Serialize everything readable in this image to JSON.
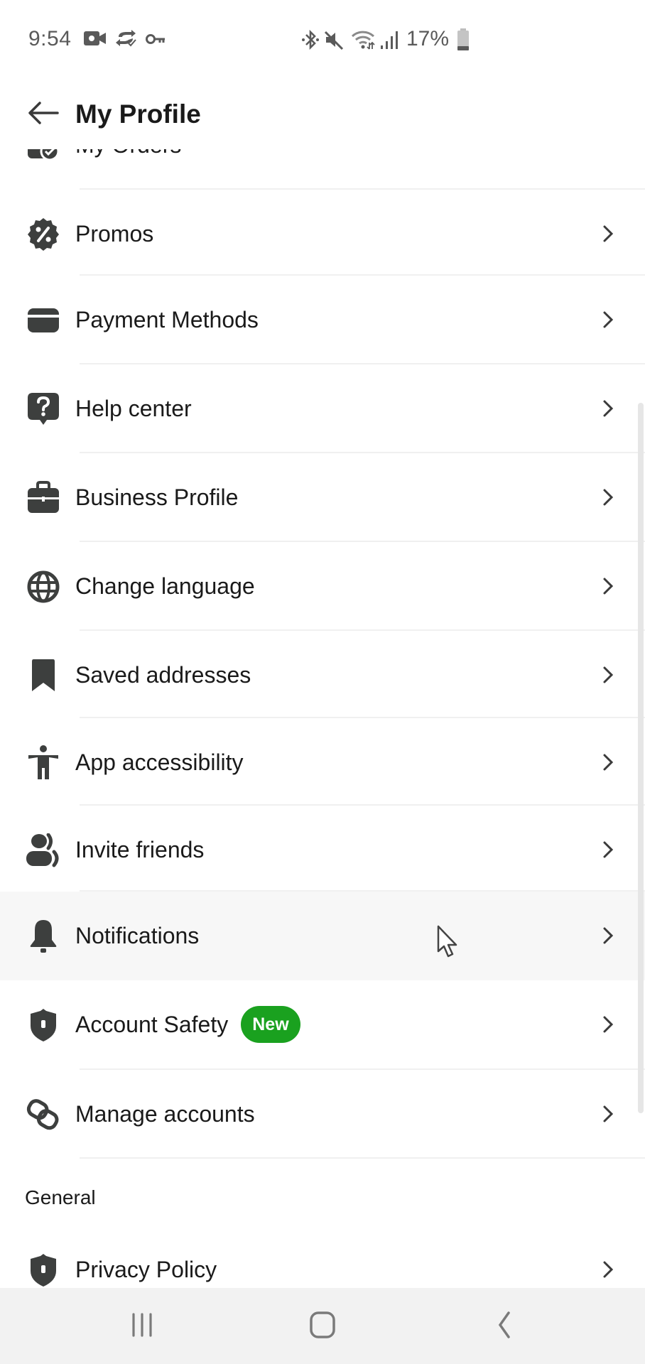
{
  "status_bar": {
    "time": "9:54",
    "left_icons": [
      "video-call-icon",
      "sync-check-icon",
      "vpn-key-icon"
    ],
    "right_icons": [
      "bluetooth-icon",
      "mute-icon",
      "wifi-icon",
      "signal-icon"
    ],
    "battery_percent": "17%"
  },
  "header": {
    "back_icon": "arrow-left-icon",
    "title": "My Profile"
  },
  "menu": {
    "partial_item": {
      "label": "My Orders",
      "icon": "orders-icon"
    },
    "items": [
      {
        "id": "promos",
        "label": "Promos",
        "icon": "promo-percent-icon"
      },
      {
        "id": "payment-methods",
        "label": "Payment Methods",
        "icon": "wallet-icon"
      },
      {
        "id": "help-center",
        "label": "Help center",
        "icon": "help-question-icon"
      },
      {
        "id": "business-profile",
        "label": "Business Profile",
        "icon": "briefcase-icon"
      },
      {
        "id": "change-language",
        "label": "Change language",
        "icon": "globe-icon"
      },
      {
        "id": "saved-addresses",
        "label": "Saved addresses",
        "icon": "bookmark-icon"
      },
      {
        "id": "app-accessibility",
        "label": "App accessibility",
        "icon": "accessibility-icon"
      },
      {
        "id": "invite-friends",
        "label": "Invite friends",
        "icon": "people-icon"
      },
      {
        "id": "notifications",
        "label": "Notifications",
        "icon": "bell-icon",
        "highlighted": true
      },
      {
        "id": "account-safety",
        "label": "Account Safety",
        "icon": "shield-icon",
        "badge": "New"
      },
      {
        "id": "manage-accounts",
        "label": "Manage accounts",
        "icon": "link-icon"
      }
    ],
    "sections": [
      {
        "title": "General",
        "items": [
          {
            "id": "privacy-policy",
            "label": "Privacy Policy",
            "icon": "shield-icon"
          }
        ]
      }
    ]
  },
  "colors": {
    "badge_green": "#1aa11f",
    "icon_dark": "#3d3f3e",
    "highlight_row": "#f7f7f7",
    "nav_bar": "#f2f2f2"
  },
  "nav_bar": {
    "buttons": [
      "recent-apps",
      "home",
      "back"
    ]
  }
}
